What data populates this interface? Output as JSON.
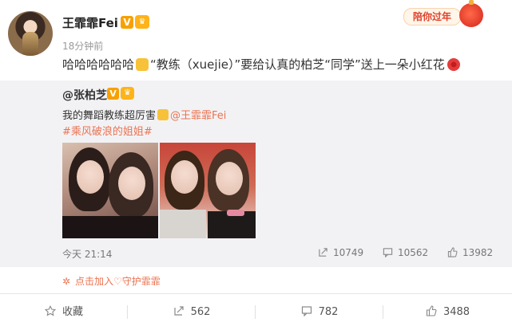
{
  "post": {
    "author": "王霏霏Fei",
    "verified_badge": "V",
    "time_ago": "18分钟前",
    "text_part1": "哈哈哈哈哈哈",
    "text_part2": "“教练（xuejie）”要给认真的柏芝“同学”送上一朵小红花",
    "corner_badge": "陪你过年"
  },
  "repost": {
    "author": "@张柏芝",
    "verified_badge": "V",
    "text": "我的舞蹈教练超厉害",
    "mention": "@王霏霏Fei",
    "topic": "#乘风破浪的姐姐#",
    "time": "今天 21:14",
    "reposts": "10749",
    "comments": "10562",
    "likes": "13982"
  },
  "guard_link": "点击加入♡守护霏霏",
  "actions": {
    "favorite": "收藏",
    "repost": "562",
    "comment": "782",
    "like": "3488"
  },
  "colors": {
    "accent": "#eb7350",
    "verified": "#f7a100",
    "repost_bg": "#f2f2f5"
  }
}
